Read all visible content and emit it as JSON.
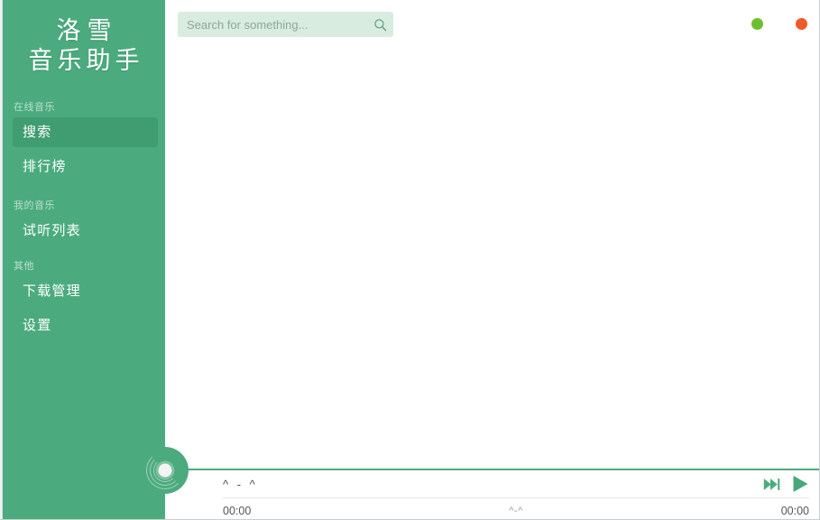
{
  "app": {
    "logo_line1": "洛雪",
    "logo_line2": "音乐助手"
  },
  "colors": {
    "sidebar_bg": "#4bab7e",
    "sidebar_active": "#3f9d71",
    "accent": "#4bab7e",
    "search_bg": "#d8ecdf",
    "minimize_dot": "#6fbe2f",
    "close_dot": "#ef5a28"
  },
  "sidebar": {
    "groups": [
      {
        "label": "在线音乐",
        "items": [
          {
            "label": "搜索",
            "active": true
          },
          {
            "label": "排行榜",
            "active": false
          }
        ]
      },
      {
        "label": "我的音乐",
        "items": [
          {
            "label": "试听列表",
            "active": false
          }
        ]
      },
      {
        "label": "其他",
        "items": [
          {
            "label": "下载管理",
            "active": false
          },
          {
            "label": "设置",
            "active": false
          }
        ]
      }
    ]
  },
  "topbar": {
    "search": {
      "value": "",
      "placeholder": "Search for something...",
      "icon": "search-icon"
    },
    "window_controls": [
      {
        "name": "minimize-button",
        "icon": "circle-icon"
      },
      {
        "name": "close-button",
        "icon": "circle-icon"
      }
    ]
  },
  "main": {
    "content": ""
  },
  "player": {
    "album_art_icon": "cd-disc-icon",
    "track_title": "^ - ^",
    "lyric_line": "^-^",
    "time_current": "00:00",
    "time_total": "00:00",
    "progress_percent": 0,
    "buttons": [
      {
        "name": "next-track-button",
        "icon": "skip-forward-icon"
      },
      {
        "name": "play-button",
        "icon": "play-icon"
      }
    ]
  }
}
